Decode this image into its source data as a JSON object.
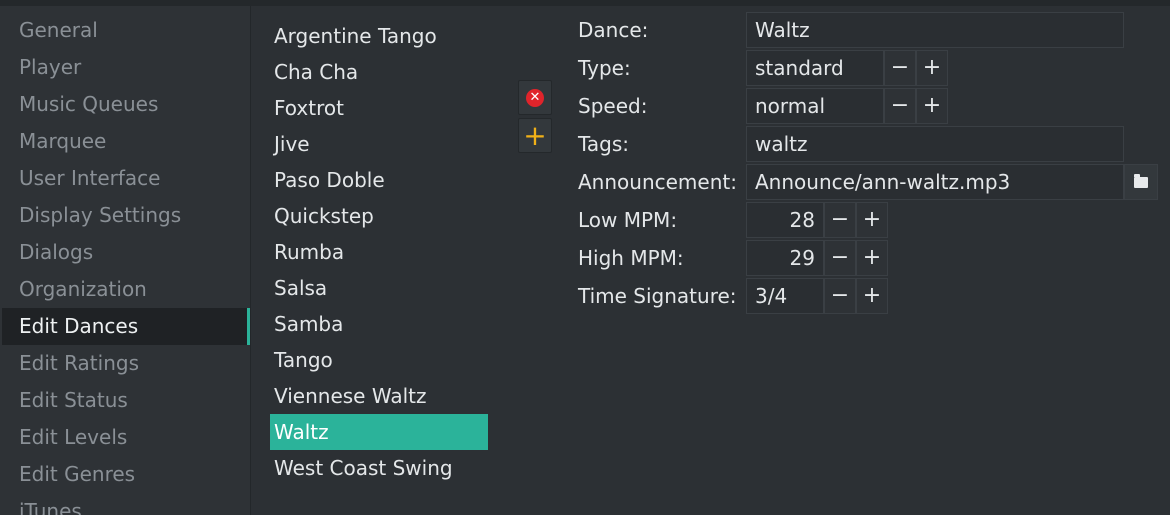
{
  "sidebar": {
    "items": [
      {
        "label": "General"
      },
      {
        "label": "Player"
      },
      {
        "label": "Music Queues"
      },
      {
        "label": "Marquee"
      },
      {
        "label": "User Interface"
      },
      {
        "label": "Display Settings"
      },
      {
        "label": "Dialogs"
      },
      {
        "label": "Organization"
      },
      {
        "label": "Edit Dances",
        "active": true
      },
      {
        "label": "Edit Ratings"
      },
      {
        "label": "Edit Status"
      },
      {
        "label": "Edit Levels"
      },
      {
        "label": "Edit Genres"
      },
      {
        "label": "iTunes"
      }
    ]
  },
  "dances": {
    "items": [
      "Argentine Tango",
      "Cha Cha",
      "Foxtrot",
      "Jive",
      "Paso Doble",
      "Quickstep",
      "Rumba",
      "Salsa",
      "Samba",
      "Tango",
      "Viennese Waltz",
      "Waltz",
      "West Coast Swing"
    ],
    "selected": "Waltz",
    "delete_icon": "delete-icon",
    "add_icon": "add-icon"
  },
  "form": {
    "dance_label": "Dance:",
    "dance_value": "Waltz",
    "type_label": "Type:",
    "type_value": "standard",
    "speed_label": "Speed:",
    "speed_value": "normal",
    "tags_label": "Tags:",
    "tags_value": "waltz",
    "announcement_label": "Announcement:",
    "announcement_value": "Announce/ann-waltz.mp3",
    "low_mpm_label": "Low MPM:",
    "low_mpm_value": "28",
    "high_mpm_label": "High MPM:",
    "high_mpm_value": "29",
    "time_sig_label": "Time Signature:",
    "time_sig_value": "3/4",
    "minus": "−",
    "plus": "+"
  },
  "colors": {
    "accent": "#2bb39a",
    "background": "#2c3034",
    "delete": "#e0242b",
    "add": "#f0b018"
  }
}
